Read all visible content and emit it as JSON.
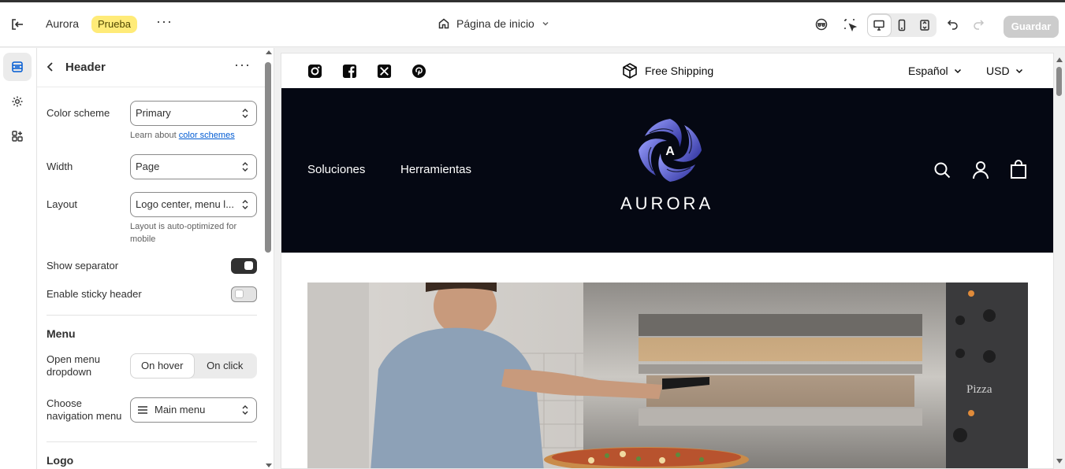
{
  "topbar": {
    "store_name": "Aurora",
    "badge": "Prueba",
    "page_selector": "Página de inicio",
    "save_label": "Guardar"
  },
  "panel": {
    "title": "Header",
    "color_scheme": {
      "label": "Color scheme",
      "value": "Primary",
      "help_prefix": "Learn about ",
      "help_link": "color schemes"
    },
    "width": {
      "label": "Width",
      "value": "Page"
    },
    "layout": {
      "label": "Layout",
      "value": "Logo center, menu l...",
      "help": "Layout is auto-optimized for mobile"
    },
    "show_separator": {
      "label": "Show separator",
      "on": true
    },
    "sticky_header": {
      "label": "Enable sticky header",
      "on": false
    },
    "menu_section": "Menu",
    "open_menu": {
      "label": "Open menu dropdown",
      "options": [
        "On hover",
        "On click"
      ],
      "selected": "On hover"
    },
    "nav_menu": {
      "label": "Choose navigation menu",
      "value": "Main menu"
    },
    "logo_section": "Logo"
  },
  "preview": {
    "announcement": "Free Shipping",
    "language": "Español",
    "currency": "USD",
    "nav": [
      "Soluciones",
      "Herramientas"
    ],
    "logo_letter": "A",
    "logo_text": "AURORA",
    "hero_sign": "Pizza",
    "colors": {
      "header_bg": "#050813",
      "logo_blue": "#4a4fc0"
    }
  }
}
